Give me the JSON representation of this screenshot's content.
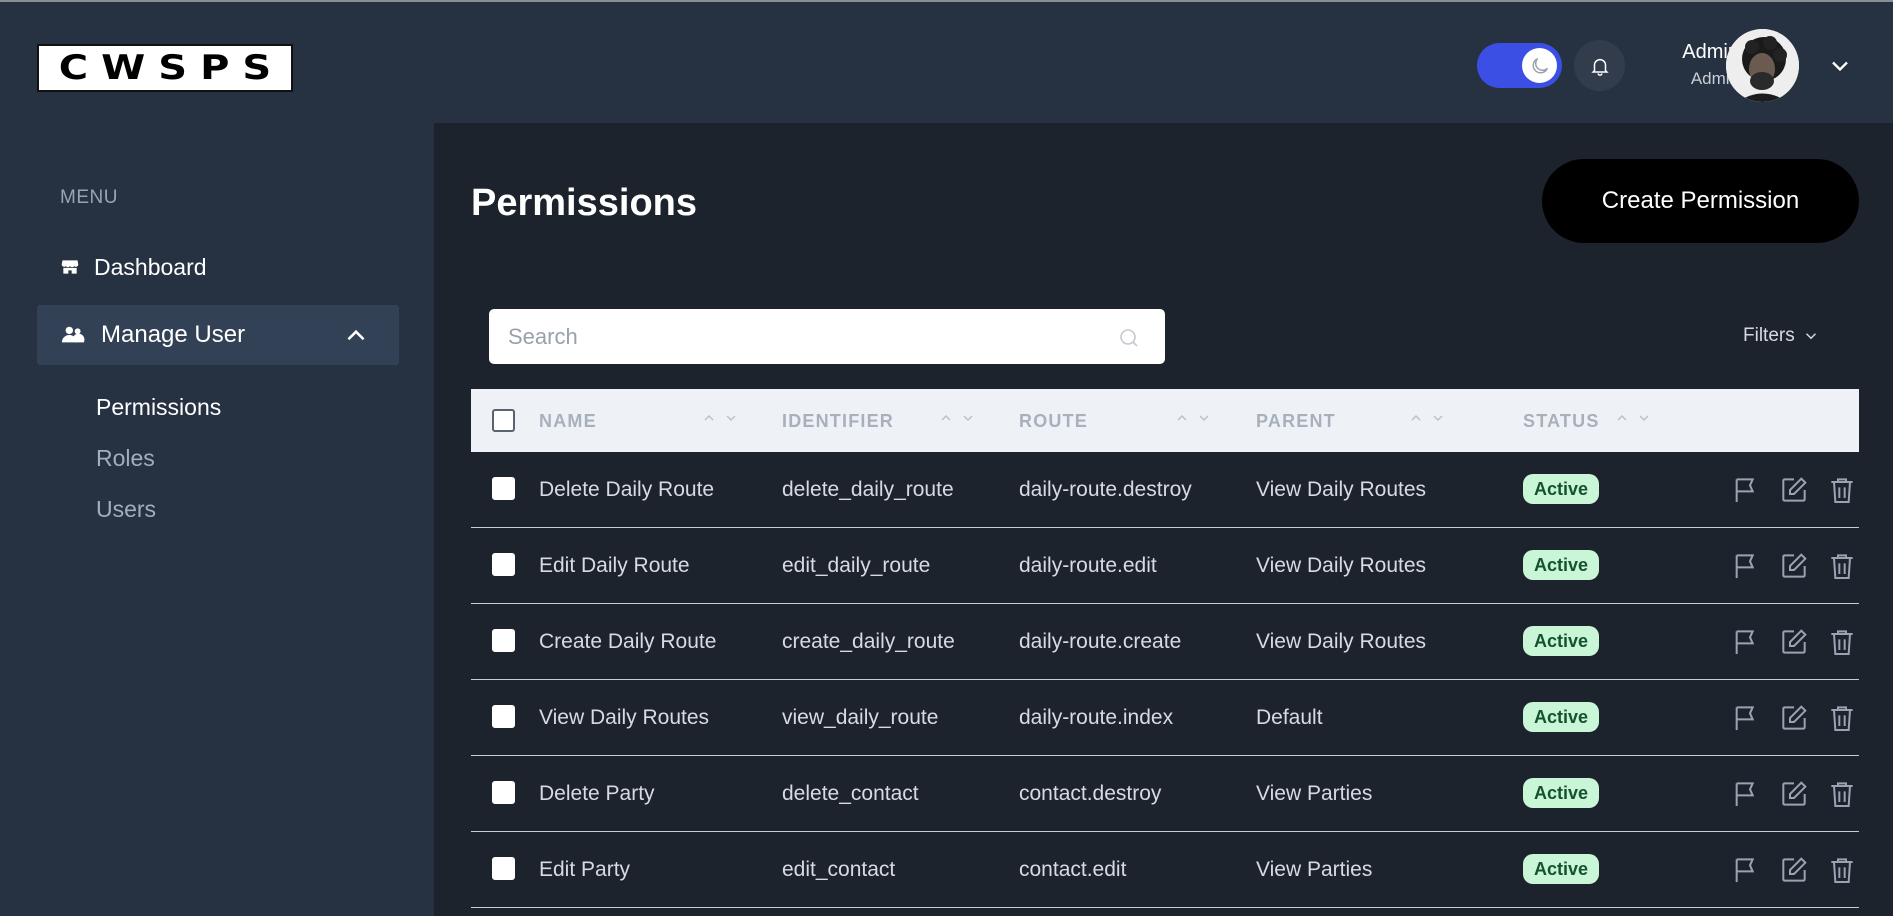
{
  "app": {
    "logo_text": "CWSPS"
  },
  "header": {
    "user_name": "Admin",
    "user_role": "Admin",
    "theme": "dark"
  },
  "sidebar": {
    "menu_title": "MENU",
    "items": [
      {
        "label": "Dashboard",
        "icon": "store-icon"
      },
      {
        "label": "Manage User",
        "icon": "users-icon",
        "expanded": true
      }
    ],
    "sub_items": [
      {
        "label": "Permissions",
        "active": true
      },
      {
        "label": "Roles",
        "active": false
      },
      {
        "label": "Users",
        "active": false
      }
    ]
  },
  "main": {
    "title": "Permissions",
    "create_label": "Create Permission",
    "search_placeholder": "Search",
    "filters_label": "Filters"
  },
  "table": {
    "columns": [
      "NAME",
      "IDENTIFIER",
      "ROUTE",
      "PARENT",
      "STATUS"
    ],
    "rows": [
      {
        "name": "Delete Daily Route",
        "identifier": "delete_daily_route",
        "route": "daily-route.destroy",
        "parent": "View Daily Routes",
        "status": "Active"
      },
      {
        "name": "Edit Daily Route",
        "identifier": "edit_daily_route",
        "route": "daily-route.edit",
        "parent": "View Daily Routes",
        "status": "Active"
      },
      {
        "name": "Create Daily Route",
        "identifier": "create_daily_route",
        "route": "daily-route.create",
        "parent": "View Daily Routes",
        "status": "Active"
      },
      {
        "name": "View Daily Routes",
        "identifier": "view_daily_route",
        "route": "daily-route.index",
        "parent": "Default",
        "status": "Active"
      },
      {
        "name": "Delete Party",
        "identifier": "delete_contact",
        "route": "contact.destroy",
        "parent": "View Parties",
        "status": "Active"
      },
      {
        "name": "Edit Party",
        "identifier": "edit_contact",
        "route": "contact.edit",
        "parent": "View Parties",
        "status": "Active"
      }
    ]
  },
  "colors": {
    "accent_toggle": "#3b4fe4",
    "status_active_bg": "#c9f6d6",
    "status_active_text": "#14532d"
  }
}
